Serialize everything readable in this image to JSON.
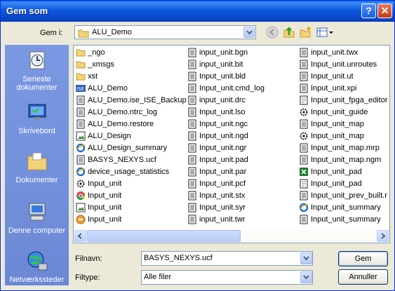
{
  "window": {
    "title": "Gem som",
    "help_label": "?",
    "close_label": "✕"
  },
  "toolbar": {
    "lookin_label": "Gem i:",
    "lookin_value": "ALU_Demo",
    "icons": [
      "back-icon",
      "up-folder-icon",
      "new-folder-icon",
      "view-menu-icon"
    ]
  },
  "places": [
    {
      "label": "Seneste dokumenter",
      "icon": "recent-documents-icon"
    },
    {
      "label": "Skrivebord",
      "icon": "desktop-icon"
    },
    {
      "label": "Dokumenter",
      "icon": "my-documents-icon"
    },
    {
      "label": "Denne computer",
      "icon": "my-computer-icon"
    },
    {
      "label": "Netværkssteder",
      "icon": "network-places-icon"
    }
  ],
  "files": {
    "col1": [
      {
        "name": "_ngo",
        "icon": "folder"
      },
      {
        "name": "_xmsgs",
        "icon": "folder"
      },
      {
        "name": "xst",
        "icon": "folder"
      },
      {
        "name": "ALU_Demo",
        "icon": "ise"
      },
      {
        "name": "ALU_Demo.ise_ISE_Backup",
        "icon": "text"
      },
      {
        "name": "ALU_Demo.ntrc_log",
        "icon": "text"
      },
      {
        "name": "ALU_Demo.restore",
        "icon": "text"
      },
      {
        "name": "ALU_Design",
        "icon": "image"
      },
      {
        "name": "ALU_Design_summary",
        "icon": "ie"
      },
      {
        "name": "BASYS_NEXYS.ucf",
        "icon": "text"
      },
      {
        "name": "device_usage_statistics",
        "icon": "ie"
      },
      {
        "name": "Input_unit",
        "icon": "gear"
      },
      {
        "name": "Input_unit",
        "icon": "chrome"
      },
      {
        "name": "Input_unit",
        "icon": "image"
      },
      {
        "name": "Input_unit",
        "icon": "orange"
      }
    ],
    "col2": [
      {
        "name": "input_unit.bgn",
        "icon": "text"
      },
      {
        "name": "input_unit.bit",
        "icon": "text"
      },
      {
        "name": "Input_unit.bld",
        "icon": "text"
      },
      {
        "name": "Input_unit.cmd_log",
        "icon": "text"
      },
      {
        "name": "input_unit.drc",
        "icon": "text"
      },
      {
        "name": "Input_unit.lso",
        "icon": "text"
      },
      {
        "name": "Input_unit.ngc",
        "icon": "text"
      },
      {
        "name": "Input_unit.ngd",
        "icon": "text"
      },
      {
        "name": "Input_unit.ngr",
        "icon": "text"
      },
      {
        "name": "Input_unit.pad",
        "icon": "text"
      },
      {
        "name": "Input_unit.par",
        "icon": "text"
      },
      {
        "name": "Input_unit.pcf",
        "icon": "text"
      },
      {
        "name": "Input_unit.stx",
        "icon": "text"
      },
      {
        "name": "Input_unit.syr",
        "icon": "text"
      },
      {
        "name": "input_unit.twr",
        "icon": "text"
      }
    ],
    "col3": [
      {
        "name": "input_unit.twx",
        "icon": "text"
      },
      {
        "name": "Input_unit.unroutes",
        "icon": "text"
      },
      {
        "name": "Input_unit.ut",
        "icon": "text"
      },
      {
        "name": "Input_unit.xpi",
        "icon": "text"
      },
      {
        "name": "Input_unit_fpga_editor",
        "icon": "doc"
      },
      {
        "name": "Input_unit_guide",
        "icon": "gear"
      },
      {
        "name": "Input_unit_map",
        "icon": "text"
      },
      {
        "name": "Input_unit_map",
        "icon": "gear"
      },
      {
        "name": "Input_unit_map.mrp",
        "icon": "text"
      },
      {
        "name": "Input_unit_map.ngm",
        "icon": "text"
      },
      {
        "name": "Input_unit_pad",
        "icon": "excel"
      },
      {
        "name": "Input_unit_pad",
        "icon": "doc"
      },
      {
        "name": "Input_unit_prev_built.r",
        "icon": "text"
      },
      {
        "name": "Input_unit_summary",
        "icon": "ie"
      },
      {
        "name": "Input_unit_summary",
        "icon": "text"
      }
    ]
  },
  "filename": {
    "label": "Filnavn:",
    "value": "BASYS_NEXYS.ucf"
  },
  "filetype": {
    "label": "Filtype:",
    "value": "Alle filer"
  },
  "buttons": {
    "save": "Gem",
    "cancel": "Annuller"
  }
}
